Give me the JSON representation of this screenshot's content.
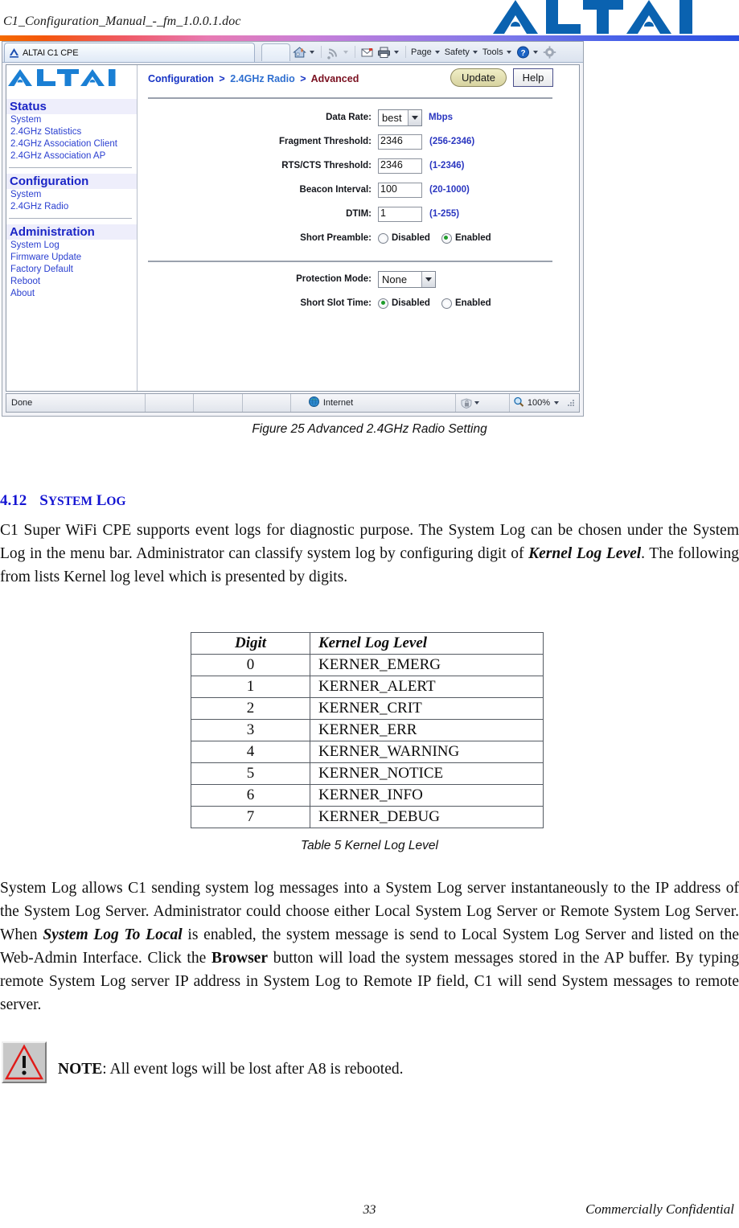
{
  "document": {
    "header_filename": "C1_Configuration_Manual_-_fm_1.0.0.1.doc",
    "brand": "ALTAI",
    "page_number": "33",
    "footer_note": "Commercially Confidential"
  },
  "browser": {
    "tab_title": "ALTAI C1 CPE",
    "toolbar": {
      "home_icon": "home-icon",
      "feeds_icon": "rss-icon",
      "mail_icon": "mail-icon",
      "print_icon": "printer-icon",
      "page_menu": "Page",
      "safety_menu": "Safety",
      "tools_menu": "Tools",
      "help_icon": "help-icon",
      "settings_icon": "gear-icon"
    },
    "status_bar": {
      "status_text": "Done",
      "zone_icon": "internet-globe-icon",
      "zone_text": "Internet",
      "protected_icon": "protected-mode-icon",
      "zoom_icon": "magnifier-icon",
      "zoom_level": "100%"
    }
  },
  "webui": {
    "breadcrumb": {
      "root": "Configuration",
      "mid": "2.4GHz Radio",
      "current": "Advanced",
      "separator": ">"
    },
    "buttons": {
      "update": "Update",
      "help": "Help"
    },
    "sidebar": {
      "groups": [
        {
          "title": "Status",
          "items": [
            "System",
            "2.4GHz Statistics",
            "2.4GHz Association Client",
            "2.4GHz Association AP"
          ]
        },
        {
          "title": "Configuration",
          "items": [
            "System",
            "2.4GHz Radio"
          ]
        },
        {
          "title": "Administration",
          "items": [
            "System Log",
            "Firmware Update",
            "Factory Default",
            "Reboot",
            "About"
          ]
        }
      ]
    },
    "form": {
      "data_rate": {
        "label": "Data Rate:",
        "value": "best",
        "unit": "Mbps"
      },
      "fragment_threshold": {
        "label": "Fragment Threshold:",
        "value": "2346",
        "range": "(256-2346)"
      },
      "rts_cts_threshold": {
        "label": "RTS/CTS Threshold:",
        "value": "2346",
        "range": "(1-2346)"
      },
      "beacon_interval": {
        "label": "Beacon Interval:",
        "value": "100",
        "range": "(20-1000)"
      },
      "dtim": {
        "label": "DTIM:",
        "value": "1",
        "range": "(1-255)"
      },
      "short_preamble": {
        "label": "Short Preamble:",
        "options": [
          "Disabled",
          "Enabled"
        ],
        "selected": "Enabled"
      },
      "protection_mode": {
        "label": "Protection Mode:",
        "value": "None"
      },
      "short_slot_time": {
        "label": "Short Slot Time:",
        "options": [
          "Disabled",
          "Enabled"
        ],
        "selected": "Disabled"
      }
    }
  },
  "figure": {
    "caption": "Figure 25    Advanced 2.4GHz Radio Setting"
  },
  "section": {
    "number": "4.12",
    "title_first": "S",
    "title_rest_1": "YSTEM",
    "title_first_2": "L",
    "title_rest_2": "OG",
    "paragraph_1_a": "C1 Super WiFi CPE supports event logs for diagnostic purpose.  The System Log can be chosen under the System Log in the menu bar.  Administrator can classify system log by configuring digit of ",
    "paragraph_1_em": "Kernel Log Level",
    "paragraph_1_b": ". The following from lists Kernel log level which is presented by digits.",
    "paragraph_2_a": "System Log allows C1 sending system log messages into a System Log server instantaneously to the IP address of the System Log Server. Administrator could choose either Local System Log Server or Remote System Log Server. When ",
    "paragraph_2_em1": "System Log To Local",
    "paragraph_2_b": " is enabled, the system message is send to Local System Log Server and listed on the Web-Admin Interface. Click the ",
    "paragraph_2_em2": "Browser",
    "paragraph_2_c": " button will load the system messages stored in the AP buffer. By typing remote System Log server IP address in System Log to Remote IP field, C1 will send System messages to remote server."
  },
  "table": {
    "caption": "Table 5    Kernel Log Level",
    "headers": [
      "Digit",
      "Kernel Log Level"
    ],
    "rows": [
      [
        "0",
        "KERNER_EMERG"
      ],
      [
        "1",
        "KERNER_ALERT"
      ],
      [
        "2",
        "KERNER_CRIT"
      ],
      [
        "3",
        "KERNER_ERR"
      ],
      [
        "4",
        "KERNER_WARNING"
      ],
      [
        "5",
        "KERNER_NOTICE"
      ],
      [
        "6",
        "KERNER_INFO"
      ],
      [
        "7",
        "KERNER_DEBUG"
      ]
    ]
  },
  "note": {
    "icon": "warning-triangle-icon",
    "label": "NOTE",
    "text": ": All event logs will be lost after A8 is rebooted."
  },
  "colors": {
    "brand_blue": "#0a62b0",
    "nav_link": "#2a3fd0",
    "nav_head": "#1b25c6",
    "hint_blue": "#2a36c0",
    "breadcrumb_current": "#7a1020",
    "section_heading": "#1414d2"
  }
}
